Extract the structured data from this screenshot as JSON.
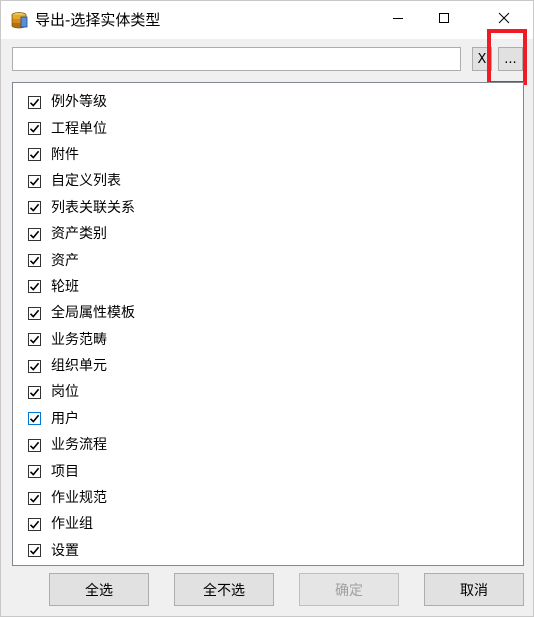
{
  "window": {
    "title": "导出-选择实体类型",
    "app_icon": "database-stack-icon",
    "controls": {
      "minimize_icon": "minimize-icon",
      "maximize_icon": "maximize-icon",
      "close_icon": "close-icon"
    }
  },
  "path_bar": {
    "value": "",
    "placeholder": "",
    "clear_label": "X",
    "browse_label": "...",
    "highlight_color": "#ee1c24"
  },
  "entity_list": {
    "items": [
      {
        "label": "例外等级",
        "checked": true
      },
      {
        "label": "工程单位",
        "checked": true
      },
      {
        "label": "附件",
        "checked": true
      },
      {
        "label": "自定义列表",
        "checked": true
      },
      {
        "label": "列表关联关系",
        "checked": true
      },
      {
        "label": "资产类别",
        "checked": true
      },
      {
        "label": "资产",
        "checked": true
      },
      {
        "label": "轮班",
        "checked": true
      },
      {
        "label": "全局属性模板",
        "checked": true
      },
      {
        "label": "业务范畴",
        "checked": true
      },
      {
        "label": "组织单元",
        "checked": true
      },
      {
        "label": "岗位",
        "checked": true
      },
      {
        "label": "用户",
        "checked": true,
        "focused": true
      },
      {
        "label": "业务流程",
        "checked": true
      },
      {
        "label": "项目",
        "checked": true
      },
      {
        "label": "作业规范",
        "checked": true
      },
      {
        "label": "作业组",
        "checked": true
      },
      {
        "label": "设置",
        "checked": true
      }
    ]
  },
  "buttons": {
    "select_all": "全选",
    "select_none": "全不选",
    "ok": "确定",
    "ok_enabled": false,
    "cancel": "取消"
  }
}
